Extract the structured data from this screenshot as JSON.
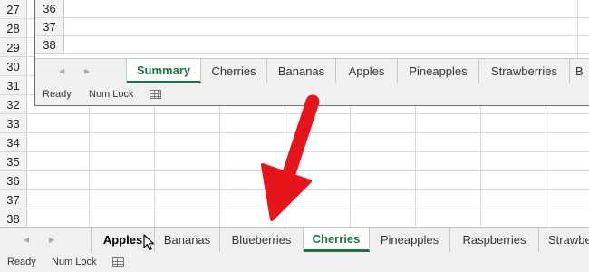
{
  "background_sheet": {
    "row_numbers": [
      "27",
      "28",
      "29",
      "30",
      "31",
      "32",
      "33",
      "34",
      "35",
      "36",
      "37",
      "38"
    ],
    "nav": {
      "prev_icon": "triangle-left",
      "next_icon": "triangle-right"
    },
    "tabs": [
      {
        "label": "Apples",
        "state": "bold-hover"
      },
      {
        "label": "Bananas",
        "state": "normal"
      },
      {
        "label": "Blueberries",
        "state": "normal"
      },
      {
        "label": "Cherries",
        "state": "active"
      },
      {
        "label": "Pineapples",
        "state": "normal"
      },
      {
        "label": "Raspberries",
        "state": "normal"
      },
      {
        "label": "Strawbe",
        "state": "partially-visible"
      }
    ],
    "status": {
      "ready": "Ready",
      "num_lock": "Num Lock",
      "icon": "sheet-icon"
    }
  },
  "inset_sheet": {
    "row_numbers": [
      "36",
      "37",
      "38"
    ],
    "nav": {
      "prev_icon": "triangle-left",
      "next_icon": "triangle-right"
    },
    "tabs": [
      {
        "label": "Summary",
        "state": "active"
      },
      {
        "label": "Cherries",
        "state": "normal"
      },
      {
        "label": "Bananas",
        "state": "normal"
      },
      {
        "label": "Apples",
        "state": "normal"
      },
      {
        "label": "Pineapples",
        "state": "normal"
      },
      {
        "label": "Strawberries",
        "state": "normal"
      },
      {
        "label": "B",
        "state": "partially-visible"
      }
    ],
    "status": {
      "ready": "Ready",
      "num_lock": "Num Lock",
      "icon": "sheet-icon"
    }
  },
  "overlay": {
    "arrow_icon": "red-arrow",
    "arrow_color": "#e8141c",
    "cursor_icon": "mouse-pointer-icon"
  },
  "colors": {
    "excel_green": "#217346",
    "active_tab_text": "#1e7145",
    "tabbar_bg": "#f0f0f0"
  }
}
